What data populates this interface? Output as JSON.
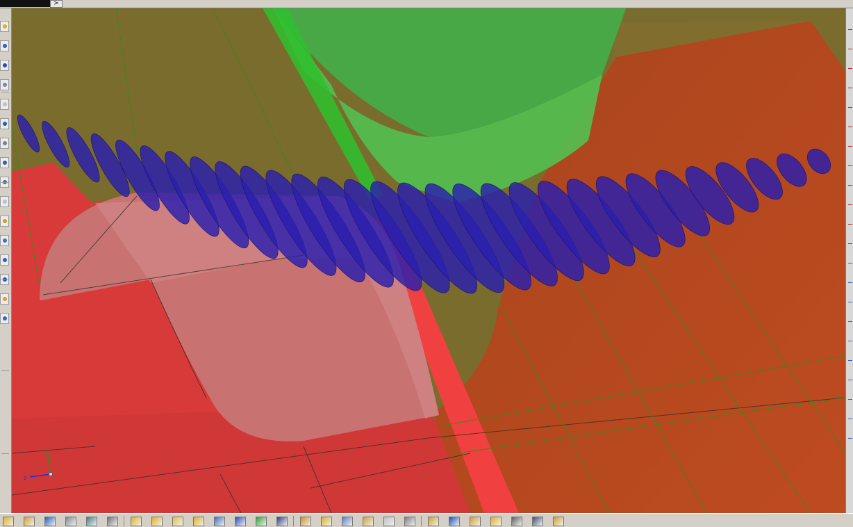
{
  "window": {
    "collapse_arrow": ">"
  },
  "viewport": {
    "axis_triad": {
      "y_label": "y",
      "x_label": "z"
    },
    "colors": {
      "background_solid": "#7c6d2a",
      "red_body": "#d83a3a",
      "pink_face": "#c97070",
      "orange_body": "#b84520",
      "green_body": "#43b043",
      "blue_slices": "#2a1fae",
      "edge_green": "#3a8a1a"
    }
  },
  "left_toolbar": {
    "icons": [
      "pointer-icon",
      "rotate-icon",
      "zoom-icon",
      "pan-icon",
      "fit-icon",
      "arc-icon",
      "hidden-line-icon",
      "shade-icon",
      "sphere-icon",
      "grid-icon",
      "view-icon",
      "triad-icon",
      "measure-icon",
      "section-icon",
      "color-icon",
      "light-icon"
    ]
  },
  "bottom_toolbar": {
    "icons": [
      "open-folder-icon",
      "snap-icon",
      "layer-icon",
      "cylinder-icon",
      "sphere-wire-icon",
      "gray-solid-icon",
      "add-part-icon",
      "add-assembly-icon",
      "star-icon",
      "add-body-icon",
      "transform-icon",
      "mirror-icon",
      "datum-icon",
      "save-icon",
      "extrude-icon",
      "cube-icon",
      "sweep-icon",
      "boolean-icon",
      "pattern-icon",
      "point-icon",
      "group-icon",
      "frame-icon",
      "lock-icon",
      "home-icon",
      "dimension-icon",
      "tree-icon",
      "export-icon"
    ]
  }
}
